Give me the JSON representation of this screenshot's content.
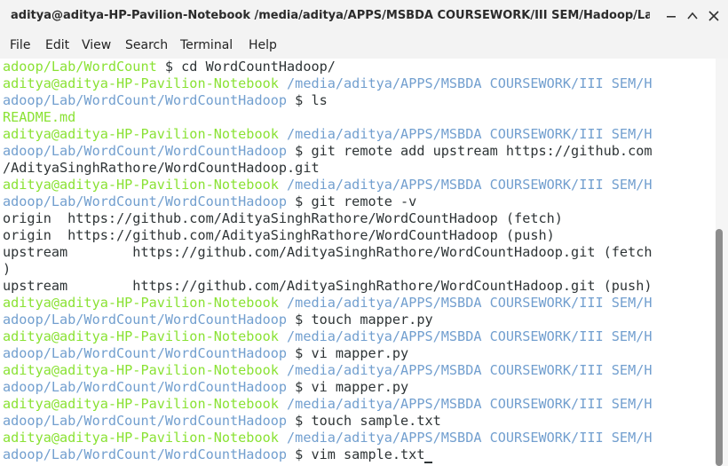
{
  "window": {
    "title": "aditya@aditya-HP-Pavilion-Notebook /media/aditya/APPS/MSBDA COURSEWORK/III SEM/Hadoop/Lab/Wo...",
    "minimize_icon": "minimize-icon",
    "maximize_icon": "maximize-icon",
    "close_icon": "close-icon"
  },
  "menu": [
    "File",
    "Edit",
    "View",
    "Search",
    "Terminal",
    "Help"
  ],
  "colors": {
    "user": "#8ae234",
    "path": "#729fcf",
    "text": "#2e3436"
  },
  "terminal": {
    "lines": [
      [
        {
          "c": "green",
          "t": "adoop/Lab/WordCount"
        },
        {
          "c": "plain",
          "t": " $ cd WordCountHadoop/"
        }
      ],
      [
        {
          "c": "green",
          "t": "aditya@aditya-HP-Pavilion-Notebook"
        },
        {
          "c": "blue",
          "t": " /media/aditya/APPS/MSBDA COURSEWORK/III SEM/H"
        }
      ],
      [
        {
          "c": "blue",
          "t": "adoop/Lab/WordCount/WordCountHadoop"
        },
        {
          "c": "plain",
          "t": " $ ls"
        }
      ],
      [
        {
          "c": "green",
          "t": "README.md"
        }
      ],
      [
        {
          "c": "green",
          "t": "aditya@aditya-HP-Pavilion-Notebook"
        },
        {
          "c": "blue",
          "t": " /media/aditya/APPS/MSBDA COURSEWORK/III SEM/H"
        }
      ],
      [
        {
          "c": "blue",
          "t": "adoop/Lab/WordCount/WordCountHadoop"
        },
        {
          "c": "plain",
          "t": " $ git remote add upstream https://github.com"
        }
      ],
      [
        {
          "c": "plain",
          "t": "/AdityaSinghRathore/WordCountHadoop.git"
        }
      ],
      [
        {
          "c": "green",
          "t": "aditya@aditya-HP-Pavilion-Notebook"
        },
        {
          "c": "blue",
          "t": " /media/aditya/APPS/MSBDA COURSEWORK/III SEM/H"
        }
      ],
      [
        {
          "c": "blue",
          "t": "adoop/Lab/WordCount/WordCountHadoop"
        },
        {
          "c": "plain",
          "t": " $ git remote -v"
        }
      ],
      [
        {
          "c": "plain",
          "t": "origin  https://github.com/AdityaSinghRathore/WordCountHadoop (fetch)"
        }
      ],
      [
        {
          "c": "plain",
          "t": "origin  https://github.com/AdityaSinghRathore/WordCountHadoop (push)"
        }
      ],
      [
        {
          "c": "plain",
          "t": "upstream        https://github.com/AdityaSinghRathore/WordCountHadoop.git (fetch"
        }
      ],
      [
        {
          "c": "plain",
          "t": ")"
        }
      ],
      [
        {
          "c": "plain",
          "t": "upstream        https://github.com/AdityaSinghRathore/WordCountHadoop.git (push)"
        }
      ],
      [
        {
          "c": "green",
          "t": "aditya@aditya-HP-Pavilion-Notebook"
        },
        {
          "c": "blue",
          "t": " /media/aditya/APPS/MSBDA COURSEWORK/III SEM/H"
        }
      ],
      [
        {
          "c": "blue",
          "t": "adoop/Lab/WordCount/WordCountHadoop"
        },
        {
          "c": "plain",
          "t": " $ touch mapper.py"
        }
      ],
      [
        {
          "c": "green",
          "t": "aditya@aditya-HP-Pavilion-Notebook"
        },
        {
          "c": "blue",
          "t": " /media/aditya/APPS/MSBDA COURSEWORK/III SEM/H"
        }
      ],
      [
        {
          "c": "blue",
          "t": "adoop/Lab/WordCount/WordCountHadoop"
        },
        {
          "c": "plain",
          "t": " $ vi mapper.py"
        }
      ],
      [
        {
          "c": "green",
          "t": "aditya@aditya-HP-Pavilion-Notebook"
        },
        {
          "c": "blue",
          "t": " /media/aditya/APPS/MSBDA COURSEWORK/III SEM/H"
        }
      ],
      [
        {
          "c": "blue",
          "t": "adoop/Lab/WordCount/WordCountHadoop"
        },
        {
          "c": "plain",
          "t": " $ vi mapper.py"
        }
      ],
      [
        {
          "c": "green",
          "t": "aditya@aditya-HP-Pavilion-Notebook"
        },
        {
          "c": "blue",
          "t": " /media/aditya/APPS/MSBDA COURSEWORK/III SEM/H"
        }
      ],
      [
        {
          "c": "blue",
          "t": "adoop/Lab/WordCount/WordCountHadoop"
        },
        {
          "c": "plain",
          "t": " $ touch sample.txt"
        }
      ],
      [
        {
          "c": "green",
          "t": "aditya@aditya-HP-Pavilion-Notebook"
        },
        {
          "c": "blue",
          "t": " /media/aditya/APPS/MSBDA COURSEWORK/III SEM/H"
        }
      ],
      [
        {
          "c": "blue",
          "t": "adoop/Lab/WordCount/WordCountHadoop"
        },
        {
          "c": "plain",
          "t": " $ vim sample.txt"
        }
      ]
    ]
  }
}
